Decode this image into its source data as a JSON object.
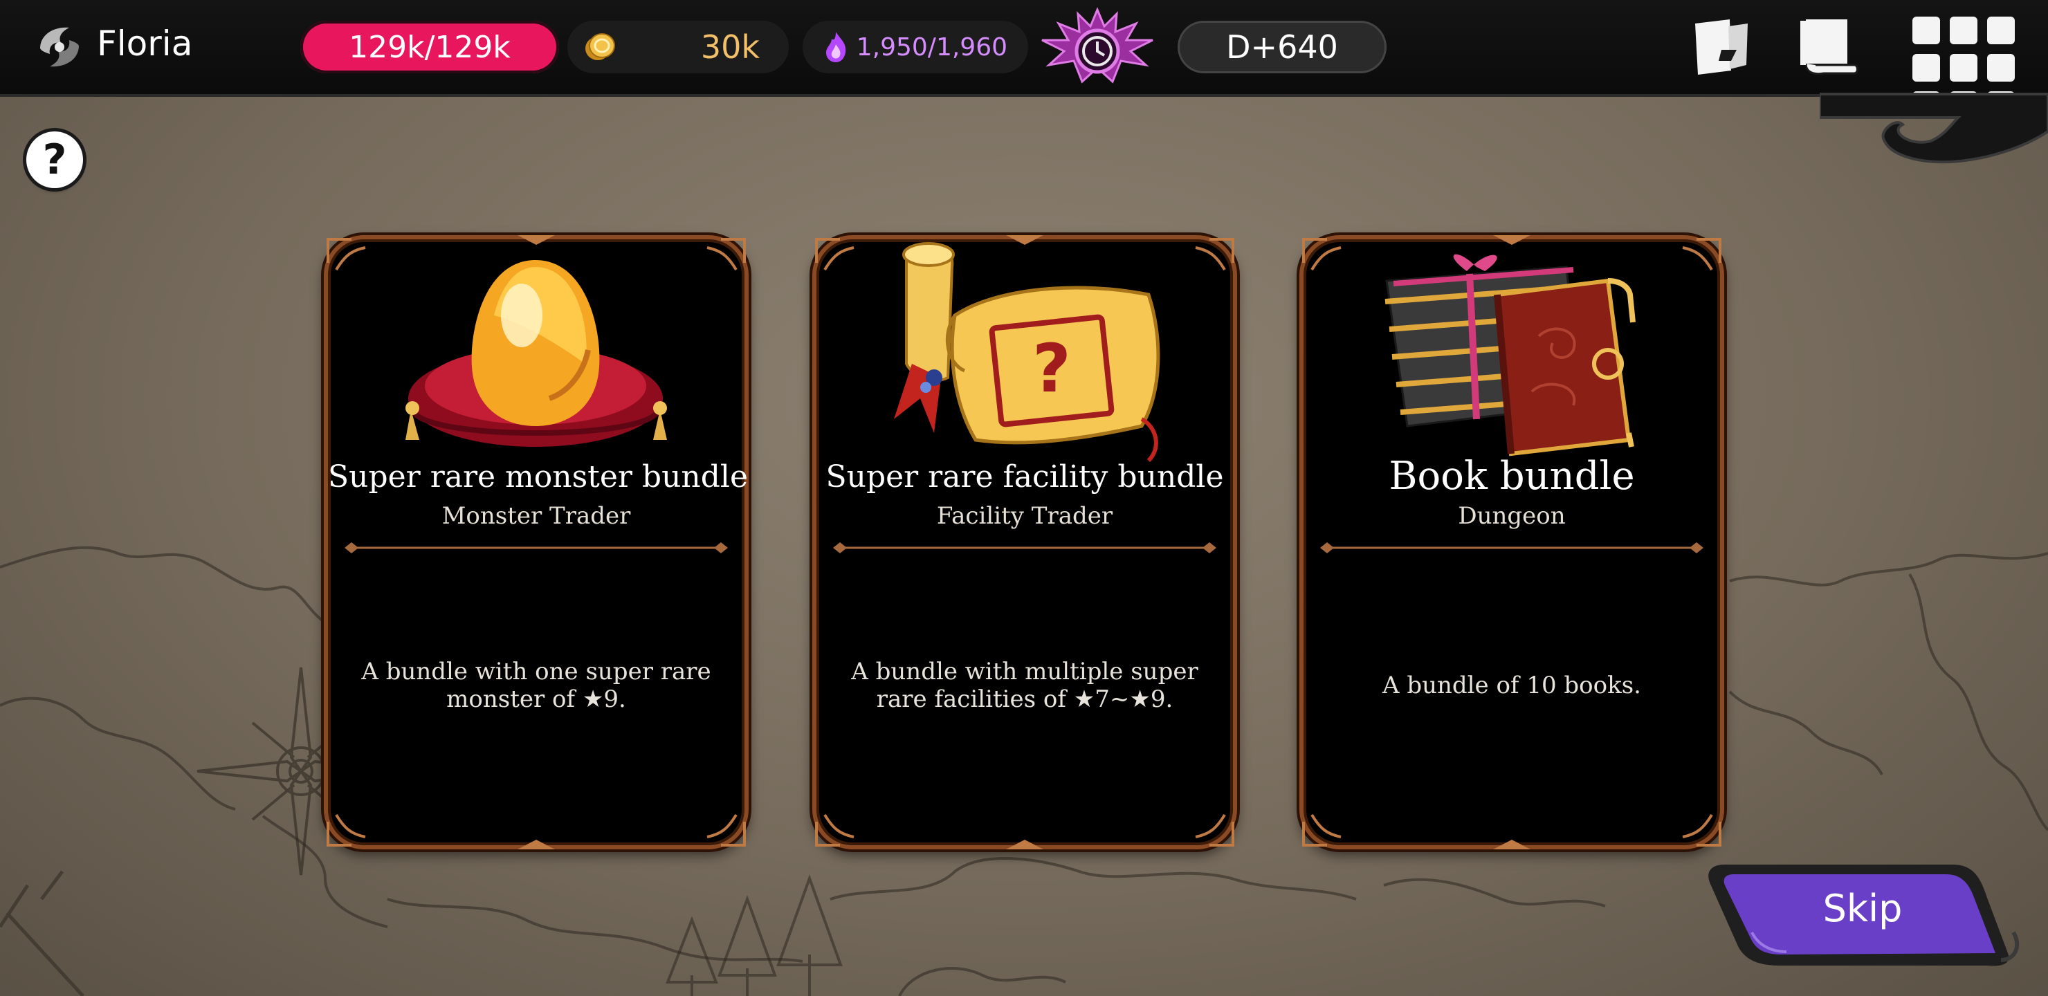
{
  "player": {
    "name": "Floria"
  },
  "resources": {
    "hp": "129k/129k",
    "gold": "30k",
    "mana": "1,950/1,960",
    "day": "D+640"
  },
  "icons": {
    "emblem": "player-emblem-icon",
    "gold": "gold-coin-icon",
    "mana": "purple-flame-icon",
    "day": "day-clock-emblem-icon",
    "quest": "quest-scroll-icon",
    "book": "book-icon",
    "menu": "menu-grid-icon",
    "help": "help-icon"
  },
  "help": {
    "label": "?"
  },
  "cards": [
    {
      "title": "Super rare monster bundle",
      "source": "Monster Trader",
      "description": "A bundle with one super rare monster of ★9.",
      "art": "golden-egg-icon"
    },
    {
      "title": "Super rare facility bundle",
      "source": "Facility Trader",
      "description": "A bundle with multiple super rare facilities of ★7~★9.",
      "art": "mystery-scroll-icon"
    },
    {
      "title": "Book bundle",
      "source": "Dungeon",
      "description": "A bundle of 10 books.",
      "art": "book-bundle-icon"
    }
  ],
  "skip": {
    "label": "Skip"
  },
  "colors": {
    "hp": "#e8175d",
    "gold": "#f2c06a",
    "mana": "#d58cff",
    "card_border": "#8a4a24",
    "skip": "#6a3fc8"
  }
}
